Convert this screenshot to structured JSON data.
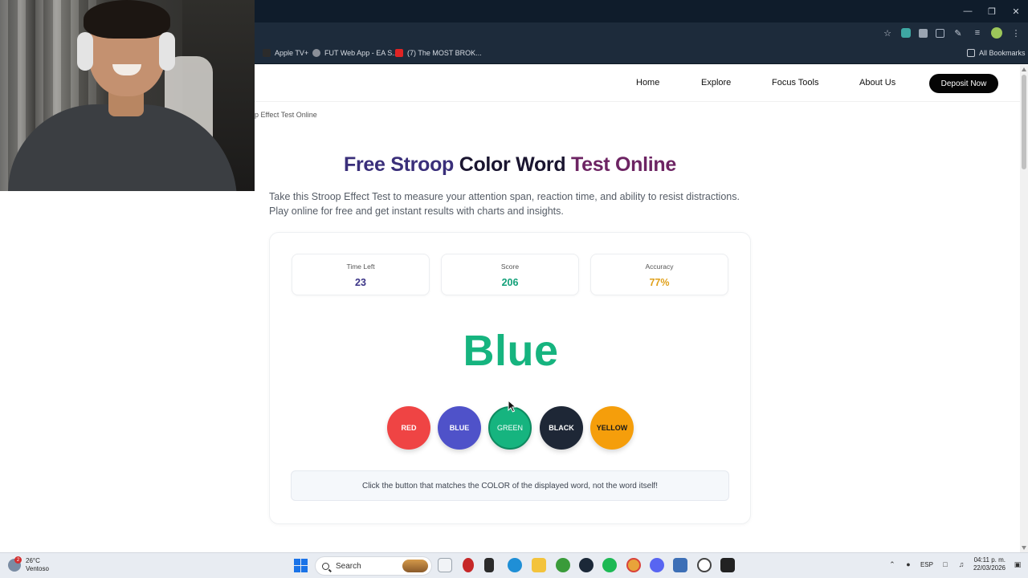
{
  "browser": {
    "bookmarks": [
      {
        "label": "Apple TV+",
        "color": "#2b2b2b"
      },
      {
        "label": "FUT Web App - EA S...",
        "color": "#8a8f98"
      },
      {
        "label": "(7) The MOST BROK...",
        "color": "#e02424"
      }
    ],
    "all_bookmarks": "All Bookmarks"
  },
  "site": {
    "nav": {
      "links": [
        "Home",
        "Explore",
        "Focus Tools",
        "About Us"
      ],
      "deposit": "Deposit Now"
    },
    "breadcrumb": "p Effect Test Online",
    "title_parts": [
      "Free Stroop ",
      "Color Word ",
      "Test Online"
    ],
    "subtitle": "Take this Stroop Effect Test to measure your attention span, reaction time, and ability to resist distractions. Play online for free and get instant results with charts and insights.",
    "stats": [
      {
        "label": "Time Left",
        "value": "23",
        "color": "#3b3487"
      },
      {
        "label": "Score",
        "value": "206",
        "color": "#12a079"
      },
      {
        "label": "Accuracy",
        "value": "77%",
        "color": "#e0a019"
      }
    ],
    "word": {
      "text": "Blue",
      "color": "#16b47f"
    },
    "buttons": [
      {
        "label": "RED",
        "color": "#ef4444"
      },
      {
        "label": "BLUE",
        "color": "#4f52c9"
      },
      {
        "label": "GREEN",
        "color": "#16b47f"
      },
      {
        "label": "BLACK",
        "color": "#1e2736"
      },
      {
        "label": "YELLOW",
        "color": "#f59e0b"
      }
    ],
    "instructions": "Click the button that matches the COLOR of the displayed word, not the word itself!"
  },
  "taskbar": {
    "weather_badge": "2",
    "temp": "26°C",
    "condition": "Ventoso",
    "search": "Search",
    "lang": "ESP",
    "time": "04:11 p. m.",
    "date": "22/03/2026"
  }
}
